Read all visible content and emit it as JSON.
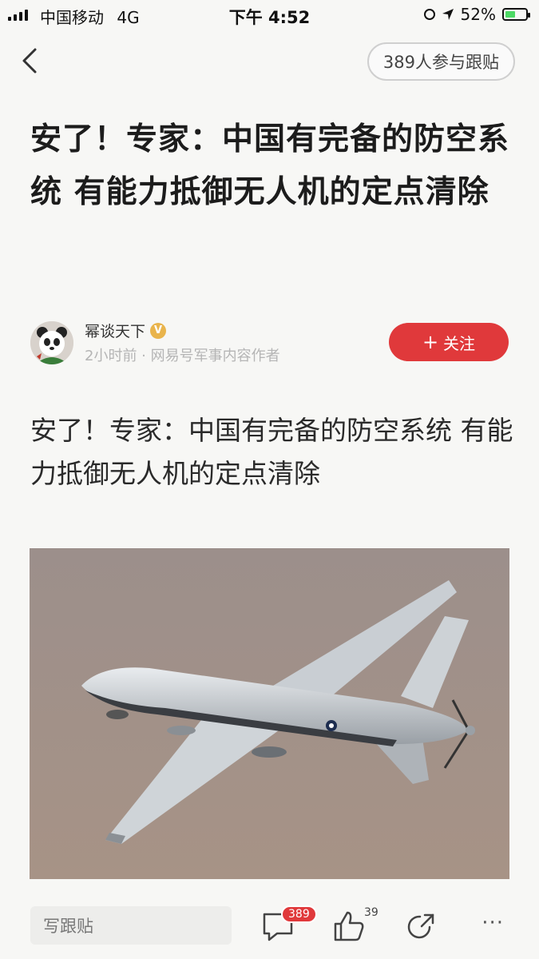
{
  "status_bar": {
    "carrier": "中国移动",
    "network": "4G",
    "time": "下午 4:52",
    "battery": "52%",
    "battery_level": 0.52
  },
  "nav": {
    "comments_pill": "389人参与跟贴"
  },
  "article": {
    "title": "安了！专家：中国有完备的防空系统 有能力抵御无人机的定点清除",
    "author": "幂谈天下",
    "meta": "2小时前 · 网易号军事内容作者",
    "follow_label": "关注",
    "body": "安了！专家：中国有完备的防空系统 有能力抵御无人机的定点清除",
    "image_alt": "drone"
  },
  "bottom_bar": {
    "compose_placeholder": "写跟贴",
    "comment_count": "389",
    "like_count": "39",
    "more": "···"
  },
  "colors": {
    "accent": "#e0393b",
    "background": "#f7f7f5"
  }
}
